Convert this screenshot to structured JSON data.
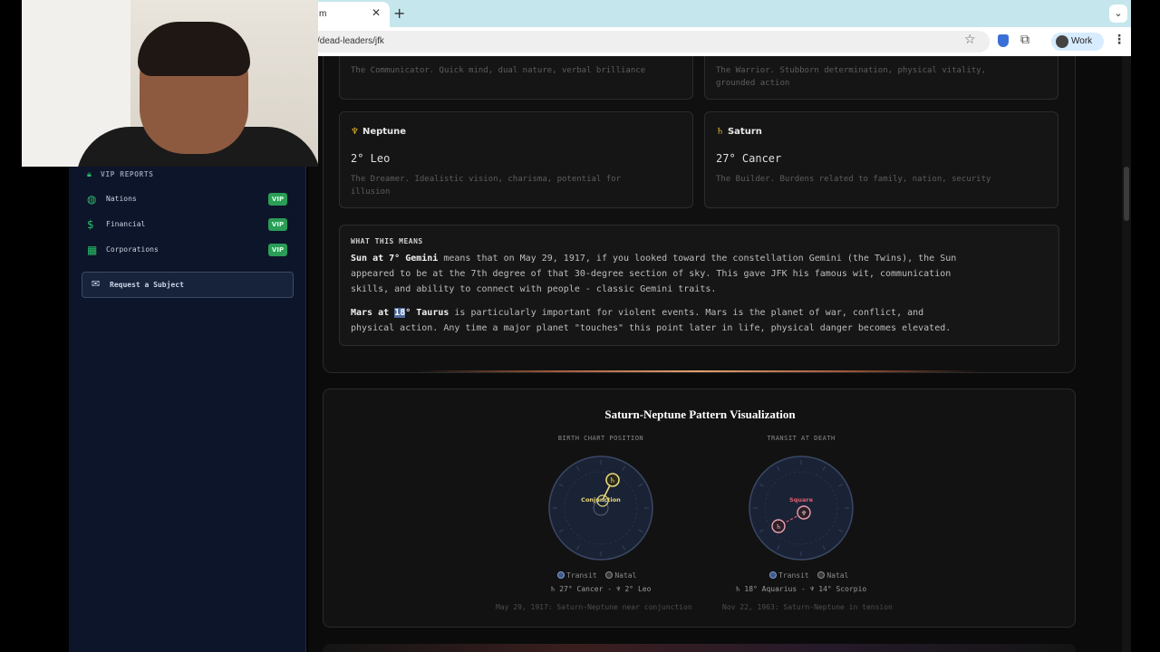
{
  "browser": {
    "tab_title": "m",
    "url_fragment": "/dead-leaders/jfk",
    "profile_label": "Work"
  },
  "sidebar": {
    "section_title": "VIP REPORTS",
    "items": [
      {
        "label": "Nations",
        "badge": "VIP",
        "icon": "globe-icon"
      },
      {
        "label": "Financial",
        "badge": "VIP",
        "icon": "dollar-icon"
      },
      {
        "label": "Corporations",
        "badge": "VIP",
        "icon": "building-icon"
      }
    ],
    "request_button": "Request a Subject"
  },
  "planets": {
    "top_left_desc": "The Communicator. Quick mind, dual nature, verbal brilliance",
    "top_right_desc_1": "The Warrior. Stubborn determination, physical vitality,",
    "top_right_desc_2": "grounded action",
    "neptune": {
      "symbol": "♆",
      "name": "Neptune",
      "position": "2° Leo",
      "desc_1": "The Dreamer. Idealistic vision, charisma, potential for",
      "desc_2": "illusion"
    },
    "saturn": {
      "symbol": "♄",
      "name": "Saturn",
      "position": "27° Cancer",
      "desc_1": "The Builder. Burdens related to family, nation, security"
    }
  },
  "meaning": {
    "title": "WHAT THIS MEANS",
    "p1_bold": "Sun at 7° Gemini",
    "p1_line1": " means that on May 29, 1917, if you looked toward the constellation Gemini (the Twins), the Sun",
    "p1_line2": "appeared to be at the 7th degree of that 30-degree section of sky. This gave JFK his famous wit, communication",
    "p1_line3": "skills, and ability to connect with people - classic Gemini traits.",
    "p2_bold_a": "Mars at ",
    "p2_bold_hl": "18",
    "p2_bold_b": "° Taurus",
    "p2_line1": " is particularly important for violent events. Mars is the planet of war, conflict, and",
    "p2_line2": "physical action. Any time a major planet \"touches\" this point later in life, physical danger becomes elevated."
  },
  "visualization": {
    "title": "Saturn-Neptune Pattern Visualization",
    "left": {
      "col_title": "BIRTH CHART POSITION",
      "aspect_label": "Conjunction",
      "saturn_glyph": "♄",
      "legend_transit": "Transit",
      "legend_natal": "Natal",
      "position_text": "♄ 27° Cancer - ♆ 2° Leo",
      "caption": "May 29, 1917: Saturn-Neptune near conjunction"
    },
    "right": {
      "col_title": "TRANSIT AT DEATH",
      "aspect_label": "Square",
      "saturn_glyph": "♄",
      "neptune_glyph": "♆",
      "legend_transit": "Transit",
      "legend_natal": "Natal",
      "position_text": "♄ 18° Aquarius - ♆ 14° Scorpio",
      "caption": "Nov 22, 1963: Saturn-Neptune in tension"
    }
  },
  "colors": {
    "accent_green": "#2bbf6a",
    "accent_gold": "#e0b12c",
    "square_red": "#e06070",
    "transit_blue": "#5a7fbf"
  }
}
